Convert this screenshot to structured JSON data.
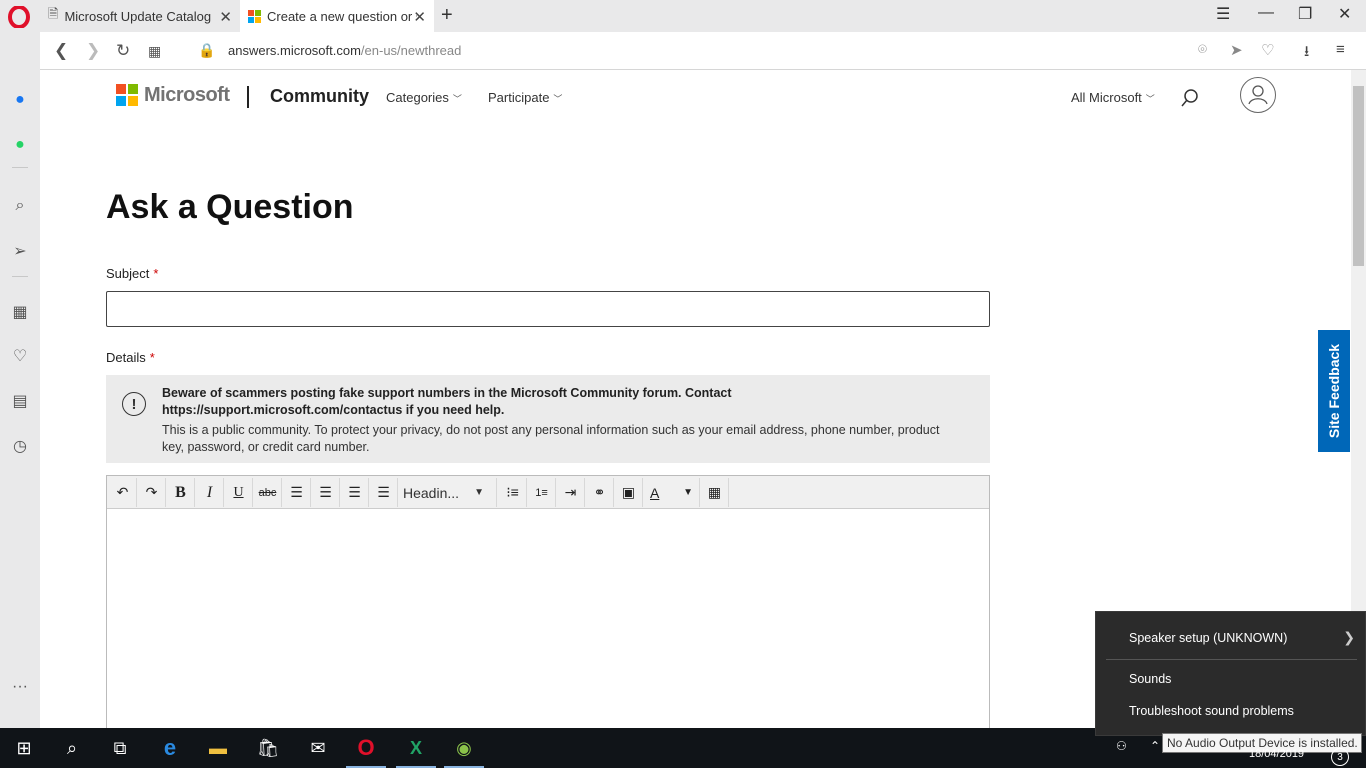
{
  "browser": {
    "tabs": [
      {
        "title": "Microsoft Update Catalog",
        "active": false
      },
      {
        "title": "Create a new question or s",
        "active": true
      }
    ],
    "address": {
      "domain": "answers.microsoft.com",
      "path": "/en-us/newthread"
    },
    "colors": {
      "opera_red": "#e0102a",
      "messenger": "#1877f2",
      "whatsapp": "#25d366"
    }
  },
  "header": {
    "brand": "Microsoft",
    "site": "Community",
    "nav": [
      "Categories",
      "Participate"
    ],
    "all_microsoft": "All Microsoft",
    "logo_colors": [
      "#f25022",
      "#7fba00",
      "#00a4ef",
      "#ffb900"
    ]
  },
  "form": {
    "title": "Ask a Question",
    "subject_label": "Subject",
    "subject_value": "",
    "details_label": "Details",
    "required_marker": "*",
    "notice_bold": "Beware of scammers posting fake support numbers in the Microsoft Community forum. Contact https://support.microsoft.com/contactus if you need help.",
    "notice_text": "This is a public community. To protect your privacy, do not post any personal information such as your email address, phone number, product key, password, or credit card number.",
    "editor_heading_select": "Headin..."
  },
  "feedback": {
    "label": "Site Feedback",
    "color": "#0067b8"
  },
  "sound_menu": {
    "items": [
      "Speaker setup (UNKNOWN)",
      "Sounds",
      "Troubleshoot sound problems"
    ]
  },
  "tray": {
    "tooltip": "No Audio Output Device is installed.",
    "date": "18/04/2019",
    "notification_count": "3"
  }
}
